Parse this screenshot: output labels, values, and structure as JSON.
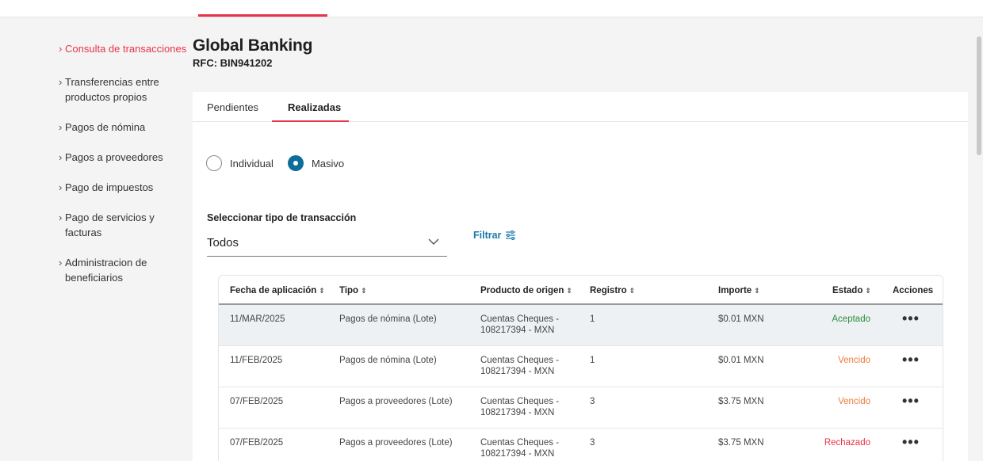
{
  "sidebar": {
    "items": [
      {
        "label": "Consulta de transacciones",
        "active": true
      },
      {
        "label": "Transferencias entre productos propios"
      },
      {
        "label": "Pagos de nómina"
      },
      {
        "label": "Pagos a proveedores"
      },
      {
        "label": "Pago de impuestos"
      },
      {
        "label": "Pago de servicios y facturas"
      },
      {
        "label": "Administracion de beneficiarios"
      }
    ]
  },
  "company": {
    "name": "Global Banking",
    "rfc": "RFC: BIN941202"
  },
  "tabs": [
    {
      "label": "Pendientes"
    },
    {
      "label": "Realizadas",
      "active": true
    }
  ],
  "radio": {
    "individual": "Individual",
    "masivo": "Masivo",
    "selected": "Masivo"
  },
  "select": {
    "label": "Seleccionar tipo de transacción",
    "value": "Todos"
  },
  "filter": {
    "label": "Filtrar"
  },
  "table": {
    "columns": [
      "Fecha de aplicación",
      "Tipo",
      "Producto de origen",
      "Registro",
      "Importe",
      "Estado",
      "Acciones"
    ],
    "rows": [
      {
        "fecha": "11/MAR/2025",
        "tipo": "Pagos de nómina (Lote)",
        "producto1": "Cuentas Cheques -",
        "producto2": "108217394 - MXN",
        "registro": "1",
        "importe": "$0.01 MXN",
        "estado": "Aceptado",
        "estado_color": "#2e8b3e"
      },
      {
        "fecha": "11/FEB/2025",
        "tipo": "Pagos de nómina (Lote)",
        "producto1": "Cuentas Cheques -",
        "producto2": "108217394 - MXN",
        "registro": "1",
        "importe": "$0.01 MXN",
        "estado": "Vencido",
        "estado_color": "#f07a3c"
      },
      {
        "fecha": "07/FEB/2025",
        "tipo": "Pagos a proveedores (Lote)",
        "producto1": "Cuentas Cheques -",
        "producto2": "108217394 - MXN",
        "registro": "3",
        "importe": "$3.75 MXN",
        "estado": "Vencido",
        "estado_color": "#f07a3c"
      },
      {
        "fecha": "07/FEB/2025",
        "tipo": "Pagos a proveedores (Lote)",
        "producto1": "Cuentas Cheques -",
        "producto2": "108217394 - MXN",
        "registro": "3",
        "importe": "$3.75 MXN",
        "estado": "Rechazado",
        "estado_color": "#e8344a"
      }
    ],
    "actions_icon": "more-horizontal-icon"
  },
  "colors": {
    "accent": "#e8344a",
    "link": "#1a7aa8",
    "radio_selected": "#0e6e9a"
  }
}
